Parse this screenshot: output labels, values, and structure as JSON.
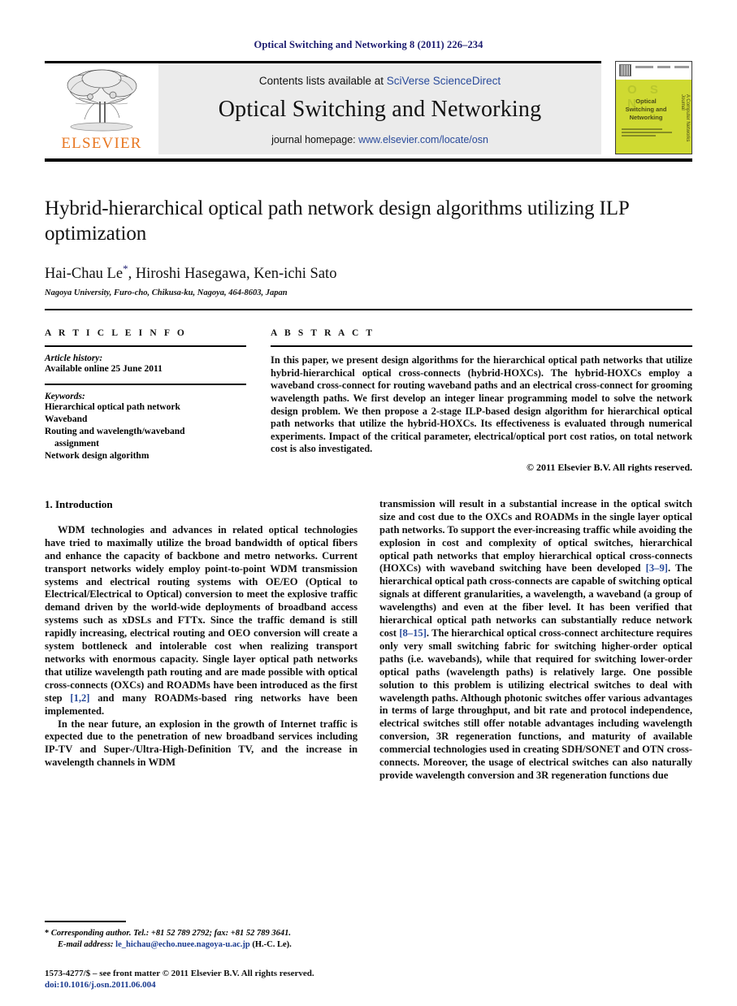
{
  "running_head": "Optical Switching and Networking 8 (2011) 226–234",
  "masthead": {
    "contents_prefix": "Contents lists available at ",
    "contents_link": "SciVerse ScienceDirect",
    "journal_title": "Optical Switching and Networking",
    "homepage_prefix": "journal homepage: ",
    "homepage_link": "www.elsevier.com/locate/osn",
    "publisher_wordmark": "ELSEVIER",
    "publisher_logo_icon": "elsevier-tree-icon",
    "link_color": "#2a4b9b",
    "elsevier_orange": "#E87722",
    "band_color": "#ebebeb"
  },
  "cover": {
    "osn_letters": "O S N",
    "journal_name_lines": "Optical Switching and Networking",
    "side_text": "A Computer Networks Journal",
    "cover_color": "#cfda32",
    "barcode_icon": "barcode-icon"
  },
  "title_block": {
    "title": "Hybrid-hierarchical optical path network design algorithms utilizing ILP optimization",
    "authors": "Hai-Chau Le*, Hiroshi Hasegawa, Ken-ichi Sato",
    "authors_plain": "Hai-Chau Le, Hiroshi Hasegawa, Ken-ichi Sato",
    "corresponding_marker": "*",
    "affiliation": "Nagoya University, Furo-cho, Chikusa-ku, Nagoya, 464-8603, Japan"
  },
  "article_info": {
    "heading": "A R T I C L E   I N F O",
    "history_label": "Article history:",
    "history_value": "Available online 25 June 2011",
    "keywords_label": "Keywords:",
    "keywords": [
      "Hierarchical optical path network",
      "Waveband",
      "Routing and wavelength/waveband",
      "assignment",
      "Network design algorithm"
    ]
  },
  "abstract": {
    "heading": "A B S T R A C T",
    "text": "In this paper, we present design algorithms for the hierarchical optical path networks that utilize hybrid-hierarchical optical cross-connects (hybrid-HOXCs). The hybrid-HOXCs employ a waveband cross-connect for routing waveband paths and an electrical cross-connect for grooming wavelength paths. We first develop an integer linear programming model to solve the network design problem. We then propose a 2-stage ILP-based design algorithm for hierarchical optical path networks that utilize the hybrid-HOXCs. Its effectiveness is evaluated through numerical experiments. Impact of the critical parameter, electrical/optical port cost ratios, on total network cost is also investigated.",
    "copyright": "© 2011 Elsevier B.V. All rights reserved."
  },
  "body": {
    "section_heading": "1.  Introduction",
    "left_paragraph_1_a": "WDM technologies and advances in related optical technologies have tried to maximally utilize the broad bandwidth of optical fibers and enhance the capacity of backbone and metro networks. Current transport networks widely employ point-to-point WDM transmission systems and electrical routing systems with OE/EO (Optical to Electrical/Electrical to Optical) conversion to meet the explosive traffic demand driven by the world-wide deployments of broadband access systems such as xDSLs and FTTx. Since the traffic demand is still rapidly increasing, electrical routing and OEO conversion will create a system bottleneck and intolerable cost when realizing transport networks with enormous capacity. Single layer optical path networks that utilize wavelength path routing and are made possible with optical cross-connects (OXCs) and ROADMs have been introduced as the first step ",
    "left_paragraph_1_ref": "[1,2]",
    "left_paragraph_1_b": " and many ROADMs-based ring networks have been implemented.",
    "left_paragraph_2": "In the near future, an explosion in the growth of Internet traffic is expected due to the penetration of new broadband services including IP-TV and Super-/Ultra-High-Definition TV, and the increase in wavelength channels in WDM",
    "right_paragraph_a": "transmission will result in a substantial increase in the optical switch size and cost due to the OXCs and ROADMs in the single layer optical path networks. To support the ever-increasing traffic while avoiding the explosion in cost and complexity of optical switches, hierarchical optical path networks that employ hierarchical optical cross-connects (HOXCs) with waveband switching have been developed ",
    "right_ref_1": "[3–9]",
    "right_paragraph_b": ". The hierarchical optical path cross-connects are capable of switching optical signals at different granularities, a wavelength, a waveband (a group of wavelengths) and even at the fiber level. It has been verified that hierarchical optical path networks can substantially reduce network cost ",
    "right_ref_2": "[8–15]",
    "right_paragraph_c": ". The hierarchical optical cross-connect architecture requires only very small switching fabric for switching higher-order optical paths (i.e. wavebands), while that required for switching lower-order optical paths (wavelength paths) is relatively large. One possible solution to this problem is utilizing electrical switches to deal with wavelength paths. Although photonic switches offer various advantages in terms of large throughput, and bit rate and protocol independence, electrical switches still offer notable advantages including wavelength conversion, 3R regeneration functions, and maturity of available commercial technologies used in creating SDH/SONET and OTN cross-connects. Moreover, the usage of electrical switches can also naturally provide wavelength conversion and 3R regeneration functions due"
  },
  "footnote": {
    "marker": "*",
    "corresponding_text": "Corresponding author. Tel.: +81 52 789 2792; fax: +81 52 789 3641.",
    "email_label": "E-mail address:",
    "email": "le_hichau@echo.nuee.nagoya-u.ac.jp",
    "email_suffix": "(H.-C. Le).",
    "email_color": "#1a3a8f"
  },
  "issn_block": {
    "line1": "1573-4277/$ – see front matter © 2011 Elsevier B.V. All rights reserved.",
    "doi": "doi:10.1016/j.osn.2011.06.004"
  }
}
